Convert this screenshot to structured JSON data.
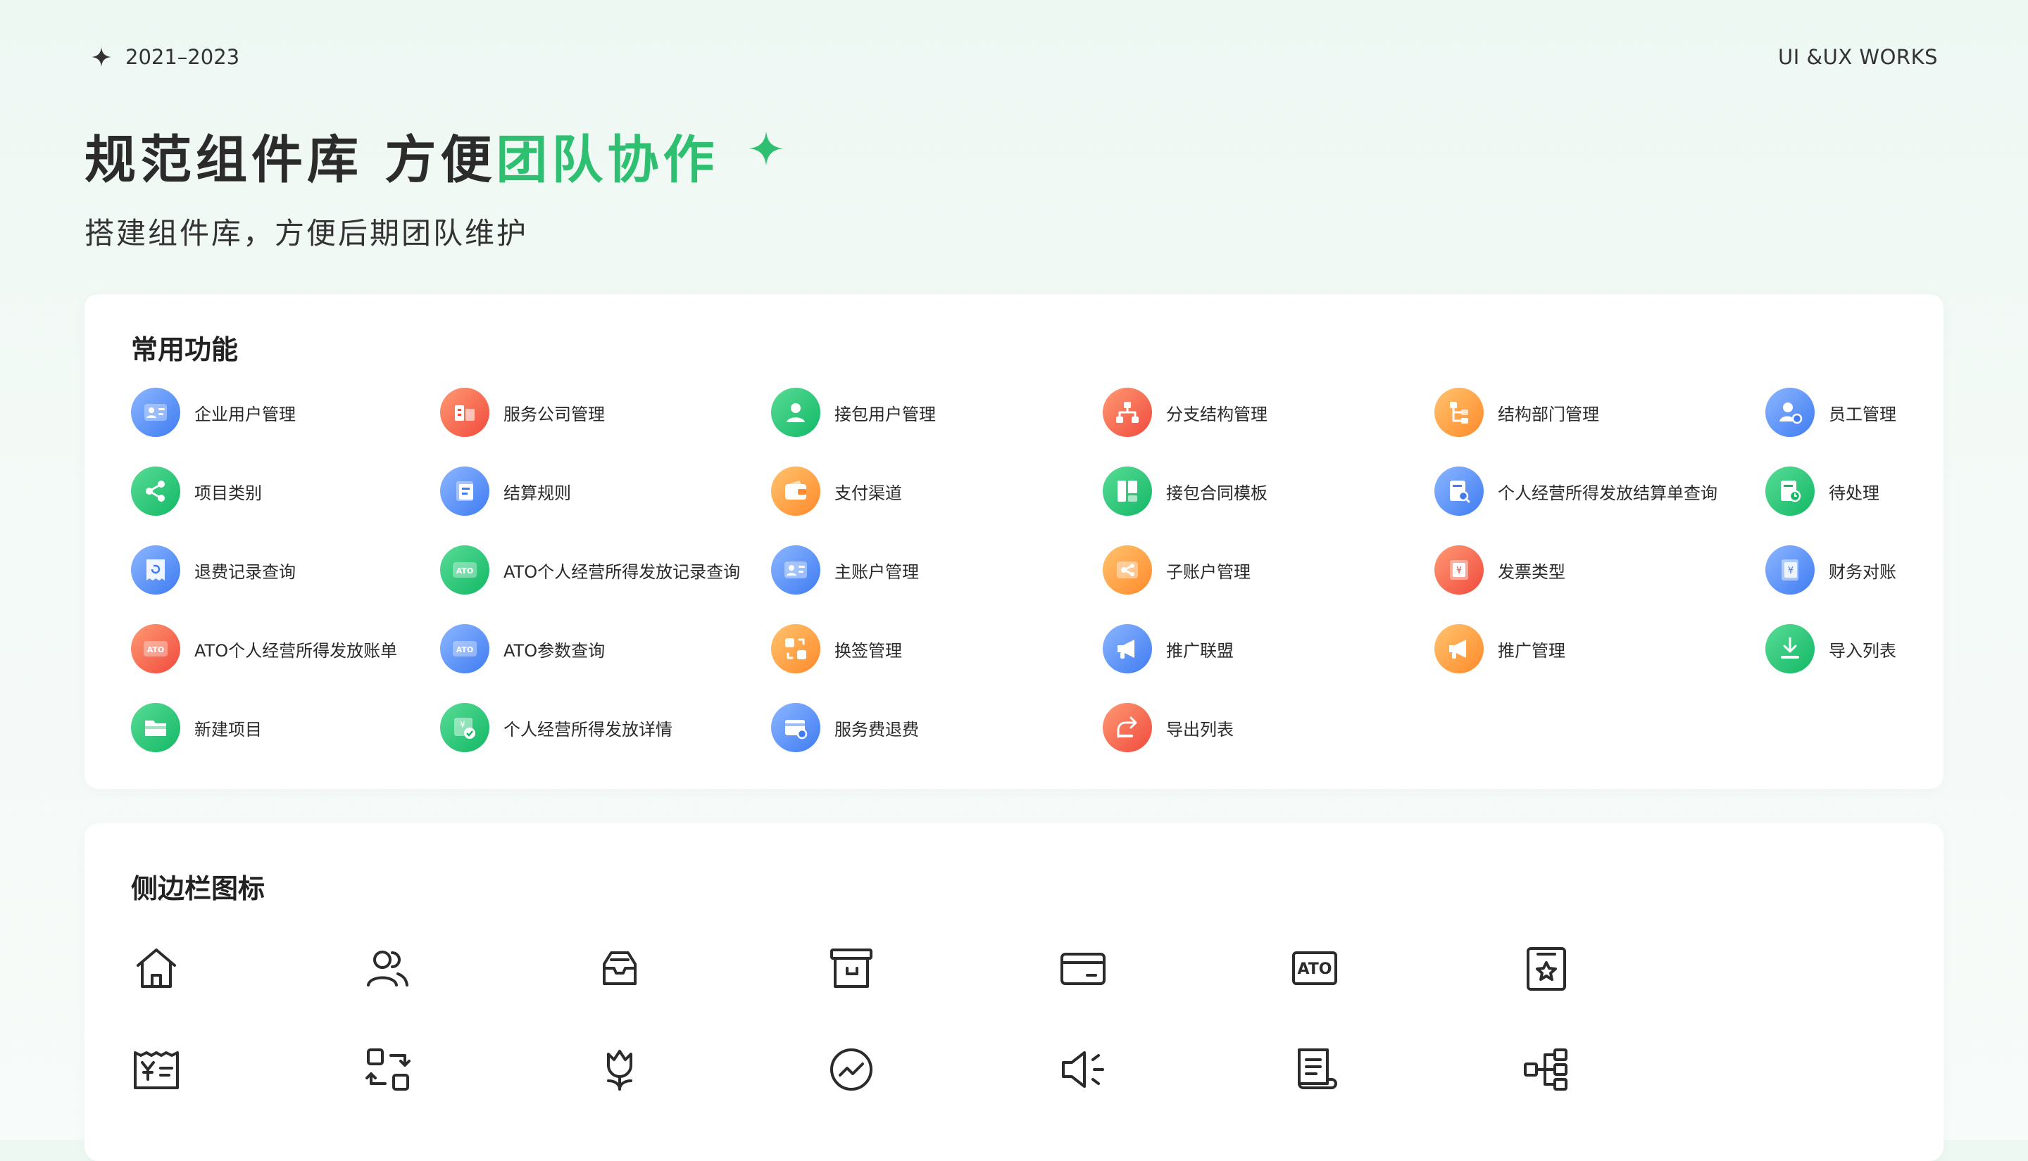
{
  "header": {
    "years": "2021–2023",
    "brand": "UI &UX WORKS",
    "title_dark": "规范组件库 方便",
    "title_green": "团队协作",
    "subtitle": "搭建组件库，方便后期团队维护"
  },
  "colors": {
    "accent_green": "#2fbf71",
    "blue": "#3f7cf2",
    "red": "#f04a3c",
    "orange": "#ff8a2b"
  },
  "common_functions": {
    "title": "常用功能",
    "items": [
      {
        "label": "企业用户管理",
        "icon": "user-card-icon",
        "color": "blue"
      },
      {
        "label": "服务公司管理",
        "icon": "building-icon",
        "color": "red"
      },
      {
        "label": "接包用户管理",
        "icon": "user-icon",
        "color": "green"
      },
      {
        "label": "分支结构管理",
        "icon": "org-tree-icon",
        "color": "red"
      },
      {
        "label": "结构部门管理",
        "icon": "hierarchy-icon",
        "color": "orange"
      },
      {
        "label": "员工管理",
        "icon": "staff-gear-icon",
        "color": "blue"
      },
      {
        "label": "项目类别",
        "icon": "share-nodes-icon",
        "color": "green"
      },
      {
        "label": "结算规则",
        "icon": "scroll-icon",
        "color": "blue"
      },
      {
        "label": "支付渠道",
        "icon": "wallet-icon",
        "color": "orange"
      },
      {
        "label": "接包合同模板",
        "icon": "layout-icon",
        "color": "green"
      },
      {
        "label": "个人经营所得发放结算单查询",
        "icon": "doc-search-icon",
        "color": "blue"
      },
      {
        "label": "待处理",
        "icon": "doc-clock-icon",
        "color": "green"
      },
      {
        "label": "退费记录查询",
        "icon": "receipt-refund-icon",
        "color": "blue"
      },
      {
        "label": "ATO个人经营所得发放记录查询",
        "icon": "ato-card-icon",
        "color": "green",
        "badge": "ATO"
      },
      {
        "label": "主账户管理",
        "icon": "id-card-icon",
        "color": "blue"
      },
      {
        "label": "子账户管理",
        "icon": "sub-account-icon",
        "color": "orange"
      },
      {
        "label": "发票类型",
        "icon": "invoice-icon",
        "color": "red"
      },
      {
        "label": "财务对账",
        "icon": "ledger-icon",
        "color": "blue"
      },
      {
        "label": "ATO个人经营所得发放账单",
        "icon": "ato-bill-icon",
        "color": "red",
        "badge": "ATO"
      },
      {
        "label": "ATO参数查询",
        "icon": "ato-param-icon",
        "color": "blue",
        "badge": "ATO"
      },
      {
        "label": "换签管理",
        "icon": "swap-icon",
        "color": "orange"
      },
      {
        "label": "推广联盟",
        "icon": "megaphone-icon",
        "color": "blue"
      },
      {
        "label": "推广管理",
        "icon": "megaphone-icon",
        "color": "orange"
      },
      {
        "label": "导入列表",
        "icon": "import-icon",
        "color": "green"
      },
      {
        "label": "新建项目",
        "icon": "folder-icon",
        "color": "green"
      },
      {
        "label": "个人经营所得发放详情",
        "icon": "money-check-icon",
        "color": "green"
      },
      {
        "label": "服务费退费",
        "icon": "card-refund-icon",
        "color": "blue"
      },
      {
        "label": "导出列表",
        "icon": "export-icon",
        "color": "red"
      }
    ]
  },
  "sidebar_icons": {
    "title": "侧边栏图标",
    "items": [
      {
        "icon": "home-icon"
      },
      {
        "icon": "users-icon"
      },
      {
        "icon": "inbox-icon"
      },
      {
        "icon": "archive-icon"
      },
      {
        "icon": "credit-card-icon"
      },
      {
        "icon": "ato-icon",
        "text": "ATO"
      },
      {
        "icon": "star-document-icon"
      },
      {
        "icon": "yen-receipt-icon"
      },
      {
        "icon": "swap-frames-icon"
      },
      {
        "icon": "tulip-icon"
      },
      {
        "icon": "trend-circle-icon"
      },
      {
        "icon": "speaker-icon"
      },
      {
        "icon": "scroll-list-icon"
      },
      {
        "icon": "hierarchy-outline-icon"
      }
    ]
  }
}
